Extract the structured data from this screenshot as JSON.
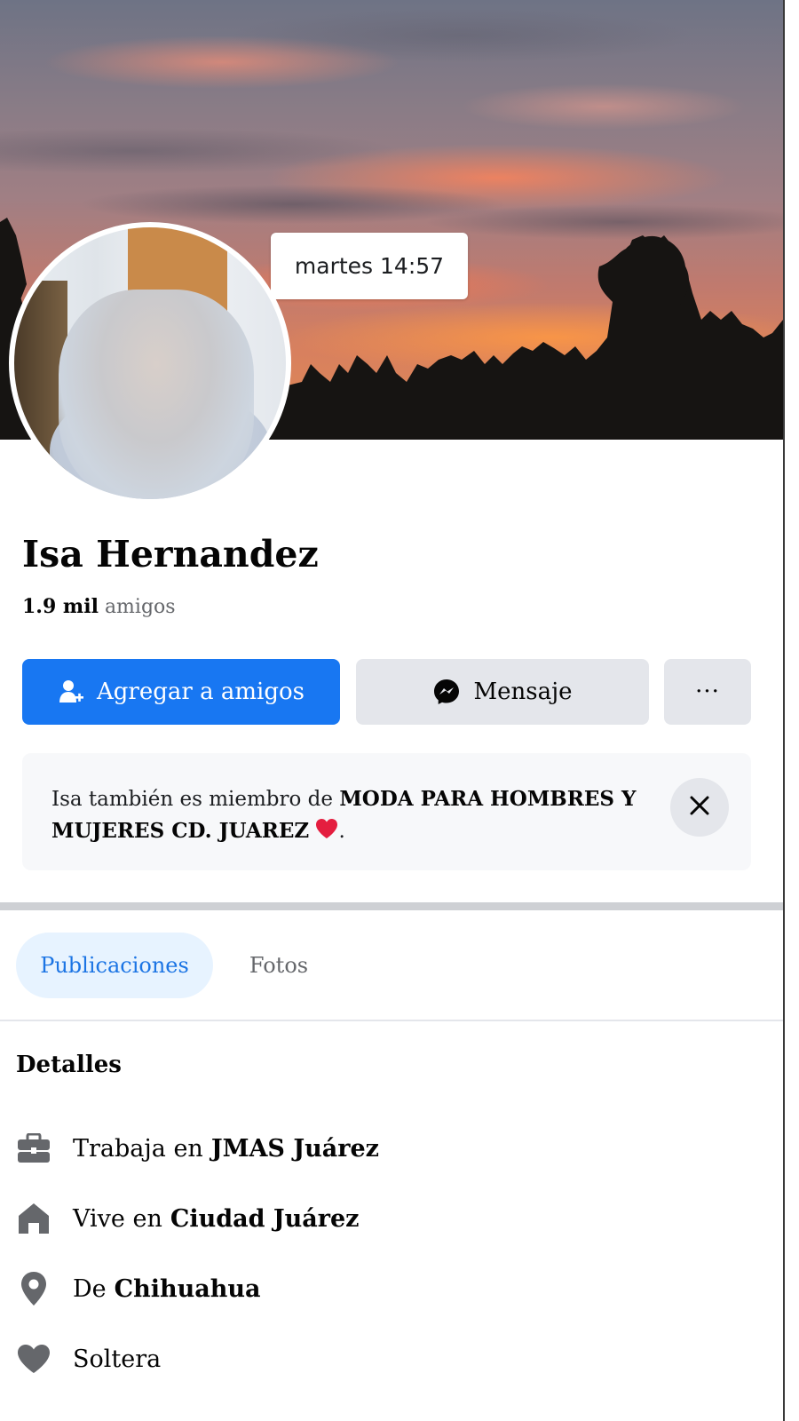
{
  "cover": {
    "timestamp": "martes 14:57"
  },
  "profile": {
    "name": "Isa Hernandez",
    "friends_count": "1.9 mil",
    "friends_label": "amigos"
  },
  "actions": {
    "add_friend": "Agregar a amigos",
    "message": "Mensaje",
    "more": "···"
  },
  "group_notice": {
    "prefix": "Isa también es miembro de ",
    "group_name": "MODA PARA HOMBRES Y MUJERES CD. JUAREZ",
    "suffix": "."
  },
  "tabs": [
    {
      "label": "Publicaciones",
      "active": true
    },
    {
      "label": "Fotos",
      "active": false
    }
  ],
  "details": {
    "title": "Detalles",
    "items": [
      {
        "icon": "briefcase-icon",
        "prefix": "Trabaja en",
        "value": "JMAS Juárez"
      },
      {
        "icon": "home-icon",
        "prefix": "Vive en",
        "value": "Ciudad Juárez"
      },
      {
        "icon": "location-pin-icon",
        "prefix": "De",
        "value": "Chihuahua"
      },
      {
        "icon": "heart-icon",
        "prefix": "Soltera",
        "value": ""
      }
    ]
  },
  "colors": {
    "primary_button": "#1877f2",
    "secondary_button": "#e4e6eb",
    "active_tab_bg": "#e7f3ff",
    "active_tab_text": "#1b74e4",
    "heart": "#e41e3f"
  }
}
